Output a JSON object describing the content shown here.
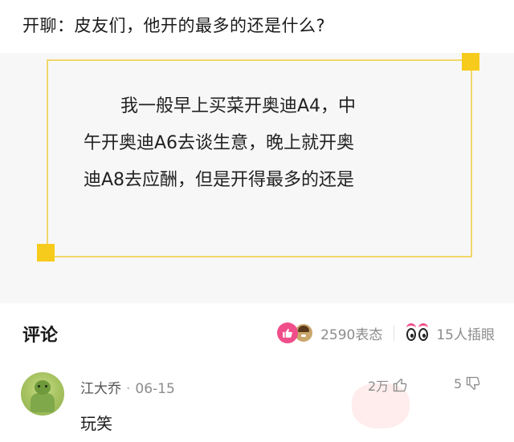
{
  "header": {
    "title": "开聊：皮友们，他开的最多的还是什么?"
  },
  "quote": {
    "line1": "我一般早上买菜开奥迪A4，中",
    "line2": "午开奥迪A6去谈生意，晚上就开奥",
    "line3": "迪A8去应酬，但是开得最多的还是"
  },
  "comments": {
    "section_title": "评论",
    "reactions_count": "2590表态",
    "insert_count": "15人插眼",
    "items": [
      {
        "author": "江大乔",
        "date": "06-15",
        "text": "玩笑",
        "likes": "2万",
        "dislikes": "5"
      }
    ]
  },
  "icons": {
    "like": "thumbs-up-icon",
    "emoji": "emoji-reaction-icon",
    "insert": "eyes-icon",
    "upvote": "thumb-up-outline-icon",
    "downvote": "thumb-down-outline-icon"
  },
  "colors": {
    "accent_pink": "#f04e8a",
    "frame_yellow": "#f1d76a",
    "corner_yellow": "#f7cb1c"
  }
}
